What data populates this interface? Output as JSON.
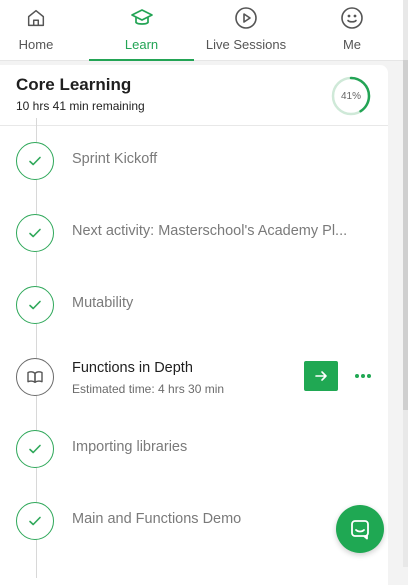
{
  "nav": {
    "tabs": [
      {
        "label": "Home",
        "icon": "home-icon"
      },
      {
        "label": "Learn",
        "icon": "graduation-cap-icon",
        "active": true
      },
      {
        "label": "Live Sessions",
        "icon": "play-circle-icon"
      },
      {
        "label": "Me",
        "icon": "smiley-icon"
      }
    ]
  },
  "course": {
    "title": "Core Learning",
    "remaining": "10 hrs 41 min remaining",
    "progress_label": "41%",
    "progress_fraction": 0.41
  },
  "items": [
    {
      "title": "Sprint Kickoff",
      "status": "done"
    },
    {
      "title": "Next activity: Masterschool's Academy Pl...",
      "status": "done"
    },
    {
      "title": "Mutability",
      "status": "done"
    },
    {
      "title": "Functions in Depth",
      "subtitle": "Estimated time: 4 hrs 30 min",
      "status": "current"
    },
    {
      "title": "Importing libraries",
      "status": "done"
    },
    {
      "title": "Main and Functions Demo",
      "status": "done"
    }
  ],
  "colors": {
    "accent": "#23a455",
    "button": "#20a853",
    "muted_text": "#7a7a7a"
  }
}
